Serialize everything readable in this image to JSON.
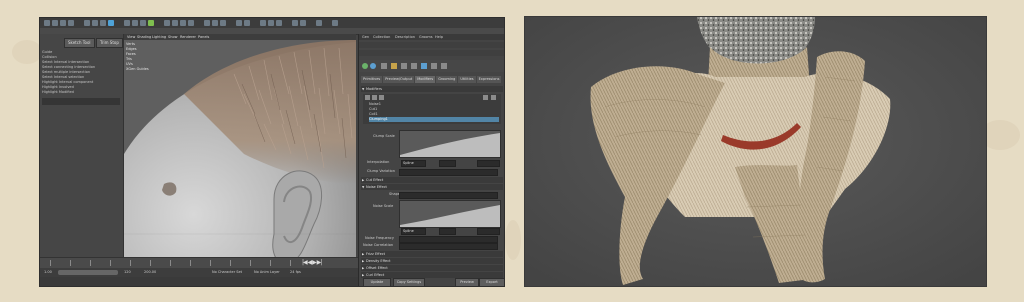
{
  "left_screenshot": {
    "left_panel": {
      "buttons": [
        "Sketch Tool",
        "Trim Stop"
      ],
      "items": [
        "Guide",
        "Collision",
        "Select Interval intersection",
        "Select connecting intersection",
        "Select multiple intersection",
        "Select Interval selection",
        "Highlight Interval component",
        "Highlight Involved",
        "Highlight Modified"
      ]
    },
    "viewport": {
      "menu": [
        "View",
        "Shading",
        "Lighting",
        "Show",
        "Renderer",
        "Panels"
      ],
      "stats": [
        "Verts",
        "Edges",
        "Faces",
        "Tris",
        "UVs",
        "XGen Guides"
      ]
    },
    "attribute_editor": {
      "menu": [
        "Gen",
        "Collection",
        "Description",
        "Grooms",
        "Help"
      ],
      "tabs": [
        "Primitives",
        "Preview/Output",
        "Modifiers",
        "Grooming",
        "Utilities",
        "Expressions"
      ],
      "active_tab": "Modifiers",
      "modifiers_header": "Modifiers",
      "modifier_items": [
        "Noise1",
        "Cut1",
        "Coil1",
        "Clumping1"
      ],
      "selected_modifier": "Clumping1",
      "labels": {
        "clump_scale": "Clump Scale",
        "interpolation": "Interpolation",
        "clump_variation": "Clump Variation",
        "noise_scale": "Noise Scale",
        "noise_frequency": "Noise Frequency",
        "noise_correlation": "Noise Correlation",
        "shape": "Shape",
        "clump": "Clump"
      },
      "interpolation_value": "Spline",
      "sections": {
        "cut_effect": "Cut Effect",
        "noise_effect": "Noise Effect",
        "frizz_effect": "Frizz Effect",
        "density_effect": "Density Effect",
        "offset_effect": "Offset Effect",
        "curl_effect": "Curl Effect"
      },
      "bottom_buttons": [
        "Preview Guides",
        "Export Guides"
      ],
      "update_buttons": [
        "Update",
        "Copy Settings",
        "Refresh"
      ]
    },
    "range_bar": {
      "start": "1.00",
      "field_value": "120",
      "end": "200.00",
      "character_set": "No Character Set",
      "anim_layer": "No Anim Layer",
      "fps": "24 fps"
    }
  }
}
